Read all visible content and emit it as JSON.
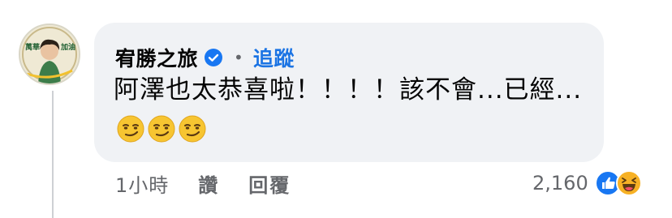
{
  "comment": {
    "author": "宥勝之旅",
    "separator": "•",
    "follow_label": "追蹤",
    "text": "阿澤也太恭喜啦！！！！該不會...已經...",
    "emojis": [
      "smirk-emoji",
      "smirk-emoji",
      "smirk-emoji"
    ]
  },
  "actions": {
    "time": "1小時",
    "like_label": "讚",
    "reply_label": "回覆"
  },
  "reactions": {
    "count": "2,160",
    "icons": [
      "like-reaction-icon",
      "haha-reaction-icon"
    ]
  },
  "avatar": {
    "text_left": "萬華",
    "text_right": "加油"
  },
  "colors": {
    "bubble": "#f0f2f5",
    "link_blue": "#1b74e4",
    "muted": "#65676b",
    "reaction_yellow": "#f7b125"
  }
}
